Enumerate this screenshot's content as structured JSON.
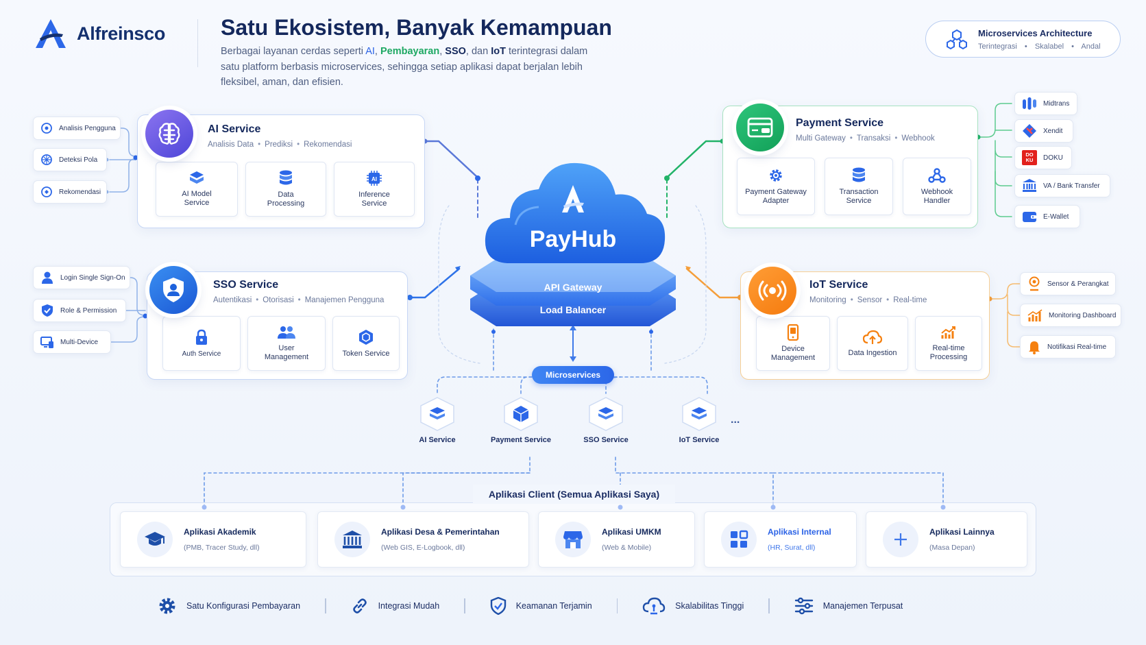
{
  "header": {
    "brand": "Alfreinsco",
    "headline": "Satu Ekosistem, Banyak Kemampuan",
    "subtitle_parts": [
      "Berbagai layanan cerdas seperti ",
      "AI",
      ", ",
      "Pembayaran",
      ", ",
      "SSO",
      ", dan ",
      "IoT",
      " terintegrasi dalam satu platform berbasis microservices, sehingga setiap aplikasi dapat berjalan lebih fleksibel, aman, dan efisien."
    ]
  },
  "badge": {
    "title": "Microservices Architecture",
    "items": [
      "Terintegrasi",
      "Skalabel",
      "Andal"
    ],
    "separator": "•"
  },
  "ai_service": {
    "title": "AI Service",
    "meta": [
      "Analisis Data",
      "Prediksi",
      "Rekomendasi"
    ],
    "subs": [
      "AI Model Service",
      "Data Processing",
      "Inference Service"
    ],
    "chips": [
      "Analisis Pengguna",
      "Deteksi Pola",
      "Rekomendasi"
    ]
  },
  "sso_service": {
    "title": "SSO Service",
    "meta": [
      "Autentikasi",
      "Otorisasi",
      "Manajemen Pengguna"
    ],
    "subs": [
      "Auth Service",
      "User Management",
      "Token Service"
    ],
    "chips": [
      "Login Single Sign-On",
      "Role & Permission",
      "Multi-Device"
    ]
  },
  "payment_service": {
    "title": "Payment Service",
    "meta": [
      "Multi Gateway",
      "Transaksi",
      "Webhook"
    ],
    "subs": [
      "Payment Gateway Adapter",
      "Transaction Service",
      "Webhook Handler"
    ],
    "chips": [
      "Midtrans",
      "Xendit",
      "DOKU",
      "VA / Bank Transfer",
      "E-Wallet"
    ],
    "doku_logo": [
      "DO",
      "KU"
    ]
  },
  "iot_service": {
    "title": "IoT Service",
    "meta": [
      "Monitoring",
      "Sensor",
      "Real-time"
    ],
    "subs": [
      "Device Management",
      "Data Ingestion",
      "Real-time Processing"
    ],
    "chips": [
      "Sensor & Perangkat",
      "Monitoring Dashboard",
      "Notifikasi Real-time"
    ]
  },
  "hub": {
    "brand": "PayHub",
    "gateway": "API Gateway",
    "load_balancer": "Load Balancer"
  },
  "microservices": {
    "label": "Microservices",
    "nodes": [
      "AI Service",
      "Payment Service",
      "SSO Service",
      "IoT Service"
    ],
    "more": "..."
  },
  "clients": {
    "title": "Aplikasi Client (Semua Aplikasi Saya)",
    "apps": [
      {
        "name": "Aplikasi Akademik",
        "desc": "(PMB, Tracer Study, dll)"
      },
      {
        "name": "Aplikasi Desa & Pemerintahan",
        "desc": "(Web GIS, E-Logbook, dll)"
      },
      {
        "name": "Aplikasi UMKM",
        "desc": "(Web & Mobile)"
      },
      {
        "name": "Aplikasi Internal",
        "desc": "(HR, Surat, dll)"
      },
      {
        "name": "Aplikasi Lainnya",
        "desc": "(Masa Depan)"
      }
    ]
  },
  "features": [
    "Satu Konfigurasi Pembayaran",
    "Integrasi Mudah",
    "Keamanan Terjamin",
    "Skalabilitas Tinggi",
    "Manajemen Terpusat"
  ],
  "colors": {
    "primary": "#2c67e8",
    "ai": "#5b4fe0",
    "sso": "#1e62dc",
    "payment": "#17a85f",
    "iot": "#f5800f",
    "navy": "#14285c"
  }
}
